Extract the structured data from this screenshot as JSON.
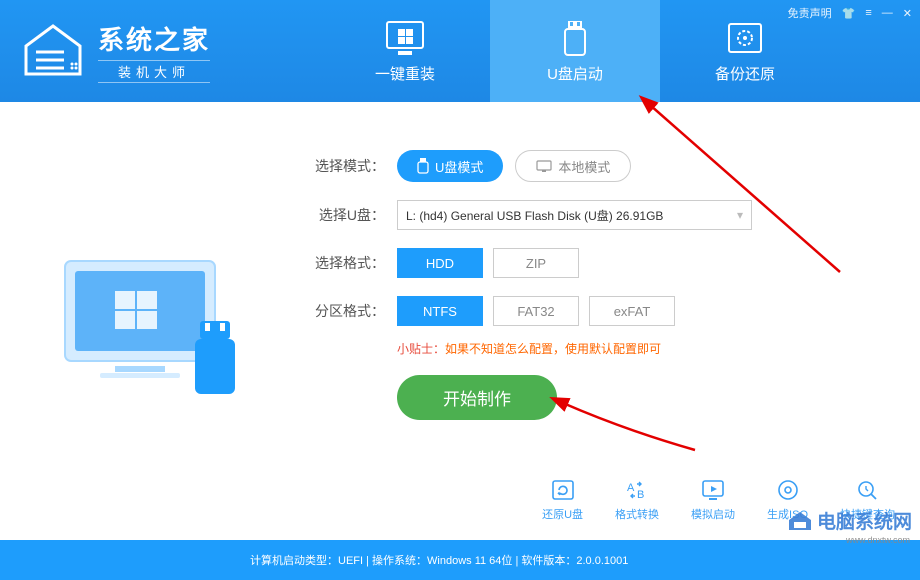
{
  "header": {
    "logo_title": "系统之家",
    "logo_sub": "装机大师",
    "declaration": "免责声明"
  },
  "nav": {
    "reinstall": "一键重装",
    "usb_boot": "U盘启动",
    "backup": "备份还原"
  },
  "form": {
    "mode_label": "选择模式：",
    "mode_usb": "U盘模式",
    "mode_local": "本地模式",
    "usb_label": "选择U盘：",
    "usb_value": "L: (hd4) General USB Flash Disk (U盘) 26.91GB",
    "format_label": "选择格式：",
    "format_hdd": "HDD",
    "format_zip": "ZIP",
    "partition_label": "分区格式：",
    "p_ntfs": "NTFS",
    "p_fat32": "FAT32",
    "p_exfat": "exFAT",
    "tip_prefix": "小贴士：",
    "tip_text": "如果不知道怎么配置，使用默认配置即可",
    "start": "开始制作"
  },
  "tools": {
    "restore": "还原U盘",
    "convert": "格式转换",
    "simulate": "模拟启动",
    "geniso": "生成ISO",
    "hotkey": "快捷键查询"
  },
  "footer": {
    "text": "计算机启动类型：UEFI | 操作系统：Windows 11 64位 | 软件版本：2.0.0.1001"
  },
  "watermark": {
    "text": "电脑系统网",
    "url": "www.dnxtw.com"
  }
}
